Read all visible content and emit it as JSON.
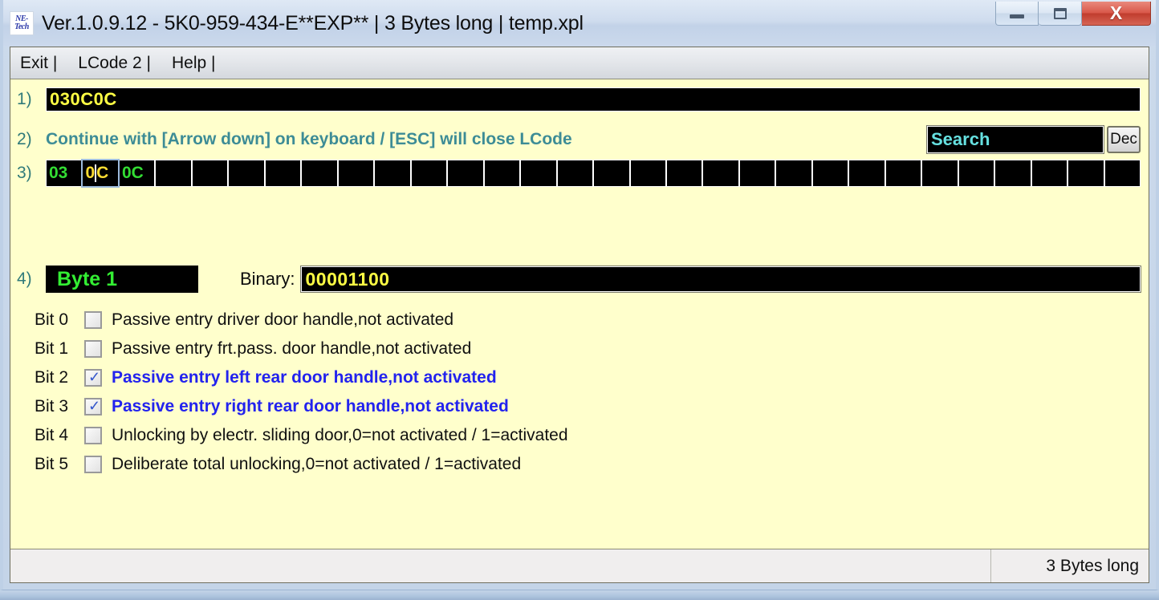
{
  "window": {
    "title": "Ver.1.0.9.12 -   5K0-959-434-E**EXP** | 3 Bytes long | temp.xpl",
    "logo_line1": "NE-",
    "logo_line2": "Tech",
    "minimize_label": "Minimize",
    "maximize_label": "Maximize",
    "close_label": "X"
  },
  "menu": {
    "items": [
      {
        "label": "Exit |"
      },
      {
        "label": "LCode 2 |"
      },
      {
        "label": "Help |"
      }
    ]
  },
  "rows": {
    "r1_label": "1)",
    "r2_label": "2)",
    "r3_label": "3)",
    "r4_label": "4)"
  },
  "hex_field": {
    "value": "030C0C"
  },
  "hint": {
    "text": "Continue with [Arrow down] on keyboard / [ESC] will close LCode"
  },
  "search": {
    "value": "Search",
    "placeholder": "Search",
    "dec_button_label": "Dec"
  },
  "byte_grid": {
    "focused_index": 1,
    "cells": [
      {
        "value": "03"
      },
      {
        "value": "0C"
      },
      {
        "value": "0C"
      },
      {
        "value": ""
      },
      {
        "value": ""
      },
      {
        "value": ""
      },
      {
        "value": ""
      },
      {
        "value": ""
      },
      {
        "value": ""
      },
      {
        "value": ""
      },
      {
        "value": ""
      },
      {
        "value": ""
      },
      {
        "value": ""
      },
      {
        "value": ""
      },
      {
        "value": ""
      },
      {
        "value": ""
      },
      {
        "value": ""
      },
      {
        "value": ""
      },
      {
        "value": ""
      },
      {
        "value": ""
      },
      {
        "value": ""
      },
      {
        "value": ""
      },
      {
        "value": ""
      },
      {
        "value": ""
      },
      {
        "value": ""
      },
      {
        "value": ""
      },
      {
        "value": ""
      },
      {
        "value": ""
      },
      {
        "value": ""
      },
      {
        "value": ""
      }
    ]
  },
  "byte_detail": {
    "name": "Byte 1",
    "binary_label": "Binary:",
    "binary_value": "00001100"
  },
  "bits": [
    {
      "name": "Bit 0",
      "checked": false,
      "label": "Passive entry driver door handle,not activated"
    },
    {
      "name": "Bit 1",
      "checked": false,
      "label": "Passive entry frt.pass. door handle,not activated"
    },
    {
      "name": "Bit 2",
      "checked": true,
      "label": "Passive entry left rear door handle,not activated"
    },
    {
      "name": "Bit 3",
      "checked": true,
      "label": "Passive entry right rear door handle,not activated"
    },
    {
      "name": "Bit 4",
      "checked": false,
      "label": "Unlocking by electr. sliding door,0=not activated / 1=activated"
    },
    {
      "name": "Bit 5",
      "checked": false,
      "label": "Deliberate total unlocking,0=not activated / 1=activated"
    }
  ],
  "statusbar": {
    "right_text": "3 Bytes long"
  },
  "colors": {
    "body_bg": "#ffffcc",
    "field_bg": "#000000",
    "hex_text": "#ffff44",
    "byte_text": "#33dd33",
    "focus_text": "#ffdd33",
    "hint_text": "#3d8c96",
    "active_bit_text": "#2222ee",
    "search_text": "#66e0e0",
    "titlebar": "#c4d4e8",
    "close_button": "#c03d2e"
  }
}
